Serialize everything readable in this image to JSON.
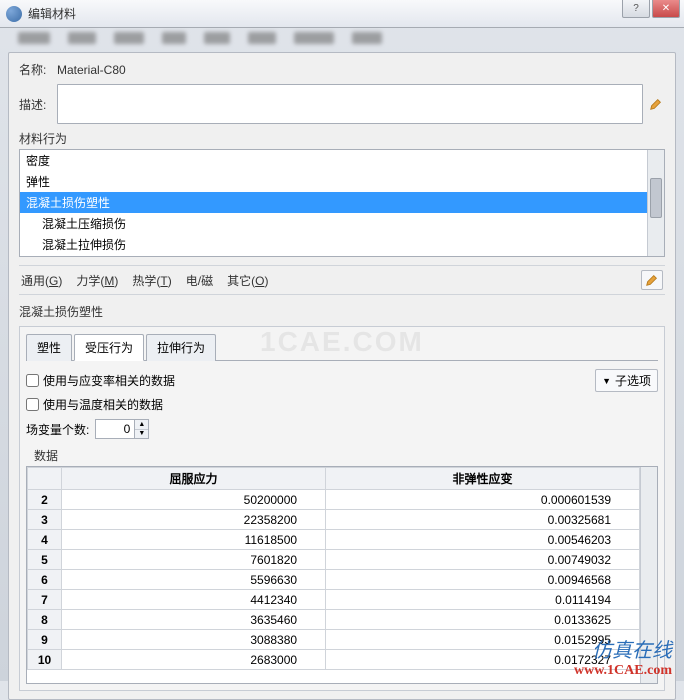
{
  "window": {
    "title": "编辑材料",
    "name_label": "名称:",
    "name_value": "Material-C80",
    "desc_label": "描述:",
    "behavior_heading": "材料行为",
    "behavior_items": [
      {
        "label": "密度",
        "indent": false,
        "selected": false
      },
      {
        "label": "弹性",
        "indent": false,
        "selected": false
      },
      {
        "label": "混凝土损伤塑性",
        "indent": false,
        "selected": true
      },
      {
        "label": "混凝土压缩损伤",
        "indent": true,
        "selected": false
      },
      {
        "label": "混凝土拉伸损伤",
        "indent": true,
        "selected": false
      }
    ],
    "menus": {
      "general": "通用",
      "general_u": "G",
      "mech": "力学",
      "mech_u": "M",
      "thermal": "热学",
      "thermal_u": "T",
      "em": "电/磁",
      "other": "其它",
      "other_u": "O"
    },
    "sub_heading": "混凝土损伤塑性",
    "tabs": [
      {
        "label": "塑性",
        "active": false
      },
      {
        "label": "受压行为",
        "active": true
      },
      {
        "label": "拉伸行为",
        "active": false
      }
    ],
    "chk_strain_rate": "使用与应变率相关的数据",
    "chk_temperature": "使用与温度相关的数据",
    "sub_options": "子选项",
    "field_var_label": "场变量个数:",
    "field_var_value": "0",
    "data_label": "数据",
    "table": {
      "col1": "屈服应力",
      "col2": "非弹性应变",
      "rows": [
        {
          "n": "2",
          "a": "50200000",
          "b": "0.000601539"
        },
        {
          "n": "3",
          "a": "22358200",
          "b": "0.00325681"
        },
        {
          "n": "4",
          "a": "11618500",
          "b": "0.00546203"
        },
        {
          "n": "5",
          "a": "7601820",
          "b": "0.00749032"
        },
        {
          "n": "6",
          "a": "5596630",
          "b": "0.00946568"
        },
        {
          "n": "7",
          "a": "4412340",
          "b": "0.0114194"
        },
        {
          "n": "8",
          "a": "3635460",
          "b": "0.0133625"
        },
        {
          "n": "9",
          "a": "3088380",
          "b": "0.0152995"
        },
        {
          "n": "10",
          "a": "2683000",
          "b": "0.0172327"
        }
      ]
    }
  },
  "watermark": {
    "l1": "仿真在线",
    "l2": "www.1CAE.com",
    "faint": "1CAE.COM"
  }
}
